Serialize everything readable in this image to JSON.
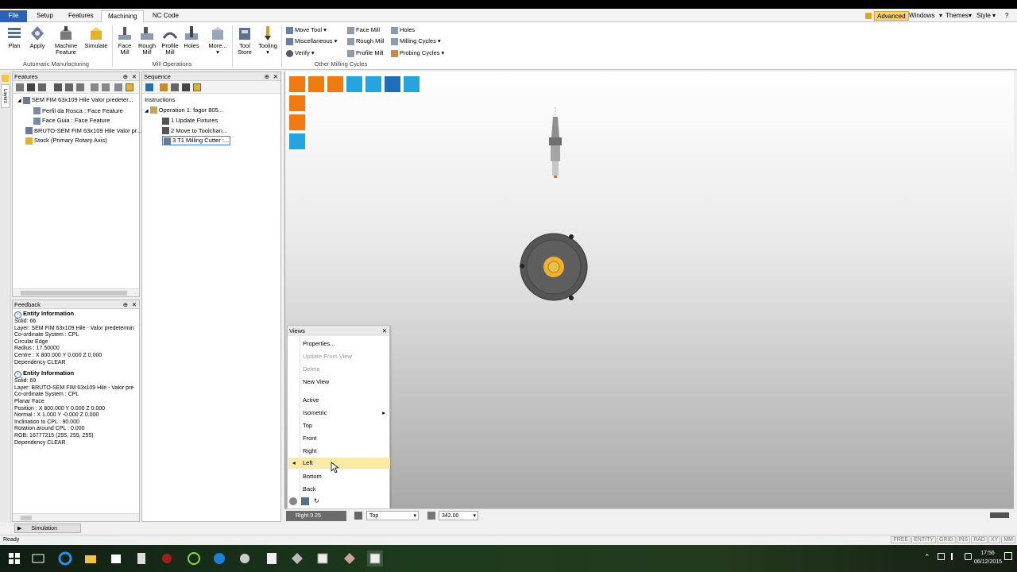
{
  "tabs": {
    "file": "File",
    "setup": "Setup",
    "features": "Features",
    "machining": "Machining",
    "nccode": "NC Code"
  },
  "right_tabs": {
    "advanced": "Advanced",
    "windows": "Windows",
    "themes": "Themes",
    "style": "Style"
  },
  "ribbon": {
    "plan": "Plan",
    "apply": "Apply",
    "machine_feature_1": "Machine",
    "machine_feature_2": "Feature",
    "simulate": "Simulate",
    "face_mill_1": "Face",
    "face_mill_2": "Mill",
    "rough_mill_1": "Rough",
    "rough_mill_2": "Mill",
    "profile_mill_1": "Profile",
    "profile_mill_2": "Mill",
    "holes": "Holes",
    "more": "More...",
    "tool_store_1": "Tool",
    "tool_store_2": "Store",
    "tooling": "Tooling",
    "move_tool": "Move Tool",
    "miscellaneous": "Miscellaneous",
    "verify": "Verify",
    "face_mill_s": "Face Mill",
    "rough_mill_s": "Rough Mill",
    "profile_mill_s": "Profile Mill",
    "holes_s": "Holes",
    "milling_cycles": "Milling Cycles",
    "probing_cycles": "Probing Cycles",
    "group_auto": "Automatic Manufacturing",
    "group_mill": "Mill Operations",
    "group_other": "Other Milling Cycles"
  },
  "left_strip": {
    "label": "Layers"
  },
  "features_panel": {
    "title": "Features",
    "items": [
      "SEM FIM 63x109 Hile Valor predeter...",
      "Perfil da Rosca :  Face Feature",
      "Face Guia :  Face Feature",
      "BRUTO-SEM FIM 63x109 Hile Valor pr...",
      "Stock (Primary Rotary Axis)"
    ]
  },
  "sequence_panel": {
    "title": "Sequence",
    "items": [
      "Instructions",
      "Operation 1: fagor 805...",
      "1 Update Fixtures",
      "2 Move to Toolchan...",
      "3 T1 Milling Cutter :..."
    ]
  },
  "feedback_panel": {
    "title": "Feedback",
    "block1": {
      "header": "Entity Information",
      "lines": [
        "Solid: 66",
        "Layer: SEM FIM 63x109 Hile - Valor predetermin",
        "Co-ordinate System : CPL",
        "Circular Edge",
        "Radius : 17.50000",
        "Centre : X     800.000 Y        0.000 Z       0.000",
        "Dependency CLEAR"
      ]
    },
    "block2": {
      "header": "Entity Information",
      "lines": [
        "Solid: 69",
        "Layer: BRUTO-SEM FIM 63x109 Hile - Valor pre",
        "Co-ordinate System : CPL",
        "Planar Face",
        "Position : X     800.000 Y        0.000 Z       0.000",
        "Normal : X       1.000 Y       -0.000 Z       0.000",
        "Inclination to CPL :        90.000",
        "Rotation around CPL :        0.000",
        "RGB: 16777215 (255, 255, 255)",
        "Dependency CLEAR"
      ]
    }
  },
  "views_menu": {
    "title": "Views",
    "items": [
      "Properties...",
      "Update From View",
      "Delete",
      "New View",
      "Active",
      "Isometric",
      "Top",
      "Front",
      "Right",
      "Left",
      "Bottom",
      "Back"
    ]
  },
  "viewport_status": {
    "view_label": "Right 0.25",
    "view_combo": "Top",
    "zoom_value": "342.00"
  },
  "sim_tab": "Simulation",
  "status": {
    "left": "Ready",
    "flags": [
      "FREE",
      "ENTITY",
      "GRID",
      "INS",
      "RAD",
      "XY",
      "MM"
    ]
  },
  "taskbar": {
    "time": "17:56",
    "date": "06/12/2015"
  },
  "colors": {
    "orange": "#f07a12",
    "cyan": "#24a3dc",
    "file_blue": "#2a62b8",
    "highlight": "#fbe9a8"
  }
}
